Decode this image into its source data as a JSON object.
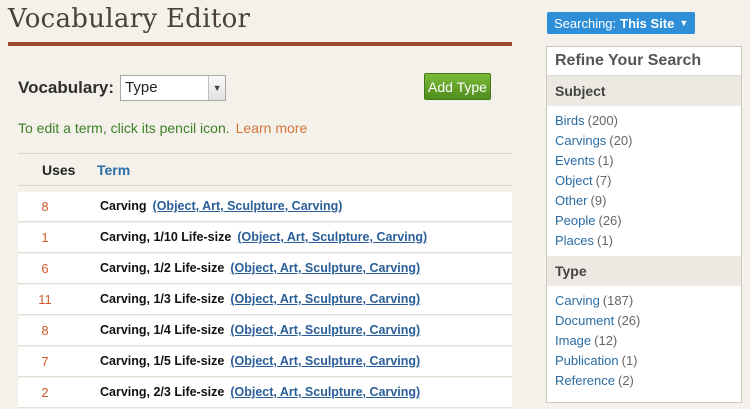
{
  "page": {
    "title": "Vocabulary Editor"
  },
  "vocab": {
    "label": "Vocabulary:",
    "selected": "Type",
    "add_button": "Add Type"
  },
  "hint": {
    "text": "To edit a term, click its pencil icon.",
    "learn_more": "Learn more"
  },
  "table": {
    "headers": {
      "uses": "Uses",
      "term": "Term"
    },
    "rows": [
      {
        "uses": "8",
        "term": "Carving",
        "path": "(Object, Art, Sculpture, Carving)"
      },
      {
        "uses": "1",
        "term": "Carving, 1/10 Life-size",
        "path": "(Object, Art, Sculpture, Carving)"
      },
      {
        "uses": "6",
        "term": "Carving, 1/2 Life-size",
        "path": "(Object, Art, Sculpture, Carving)"
      },
      {
        "uses": "11",
        "term": "Carving, 1/3 Life-size",
        "path": "(Object, Art, Sculpture, Carving)"
      },
      {
        "uses": "8",
        "term": "Carving, 1/4 Life-size",
        "path": "(Object, Art, Sculpture, Carving)"
      },
      {
        "uses": "7",
        "term": "Carving, 1/5 Life-size",
        "path": "(Object, Art, Sculpture, Carving)"
      },
      {
        "uses": "2",
        "term": "Carving, 2/3 Life-size",
        "path": "(Object, Art, Sculpture, Carving)"
      }
    ]
  },
  "search": {
    "label": "Searching:",
    "scope": "This Site",
    "caret_icon": "caret-down-icon"
  },
  "refine": {
    "title": "Refine Your Search",
    "facets": [
      {
        "name": "Subject",
        "items": [
          {
            "name": "Birds",
            "count": "(200)"
          },
          {
            "name": "Carvings",
            "count": "(20)"
          },
          {
            "name": "Events",
            "count": "(1)"
          },
          {
            "name": "Object",
            "count": "(7)"
          },
          {
            "name": "Other",
            "count": "(9)"
          },
          {
            "name": "People",
            "count": "(26)"
          },
          {
            "name": "Places",
            "count": "(1)"
          }
        ]
      },
      {
        "name": "Type",
        "items": [
          {
            "name": "Carving",
            "count": "(187)"
          },
          {
            "name": "Document",
            "count": "(26)"
          },
          {
            "name": "Image",
            "count": "(12)"
          },
          {
            "name": "Publication",
            "count": "(1)"
          },
          {
            "name": "Reference",
            "count": "(2)"
          }
        ]
      }
    ]
  },
  "colors": {
    "accent_rule": "#9b4a2a",
    "add_button": "#5e9f25",
    "search_button": "#2e8fd8",
    "link": "#2b6ca3",
    "uses": "#d05a2c"
  }
}
